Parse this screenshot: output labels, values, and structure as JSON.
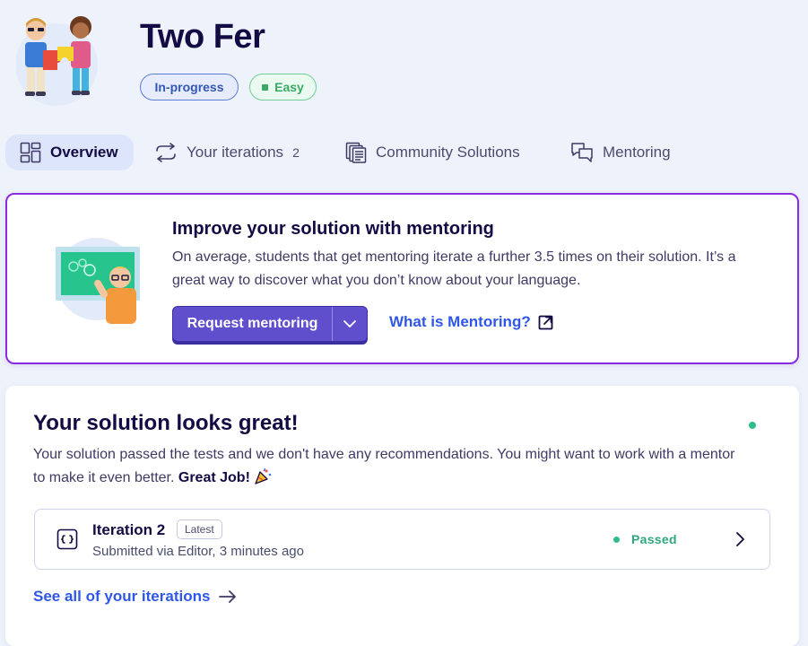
{
  "exercise": {
    "title": "Two Fer",
    "status_badge": "In-progress",
    "difficulty_badge": "Easy"
  },
  "tabs": [
    {
      "label": "Overview",
      "icon": "overview-icon",
      "active": true
    },
    {
      "label": "Your iterations",
      "count": "2",
      "icon": "iterations-icon"
    },
    {
      "label": "Community Solutions",
      "icon": "community-solutions-icon"
    },
    {
      "label": "Mentoring",
      "icon": "mentoring-icon"
    }
  ],
  "mentoring_card": {
    "title": "Improve your solution with mentoring",
    "description": "On average, students that get mentoring iterate a further 3.5 times on their solution. It’s a great way to discover what you don’t know about your language.",
    "button_label": "Request mentoring",
    "link_label": "What is Mentoring?"
  },
  "solution_card": {
    "title": "Your solution looks great!",
    "description": "Your solution passed the tests and we don't have any recommendations. You might want to work with a mentor to make it even better.",
    "praise": "Great Job!",
    "iteration": {
      "name": "Iteration 2",
      "latest_label": "Latest",
      "submitted": "Submitted via Editor, 3 minutes ago",
      "status": "Passed"
    },
    "see_all_label": "See all of your iterations"
  },
  "colors": {
    "accent": "#604fcd",
    "link": "#2e57e8",
    "passed": "#2fbc8a",
    "mentor_border": "#8a2be2"
  }
}
